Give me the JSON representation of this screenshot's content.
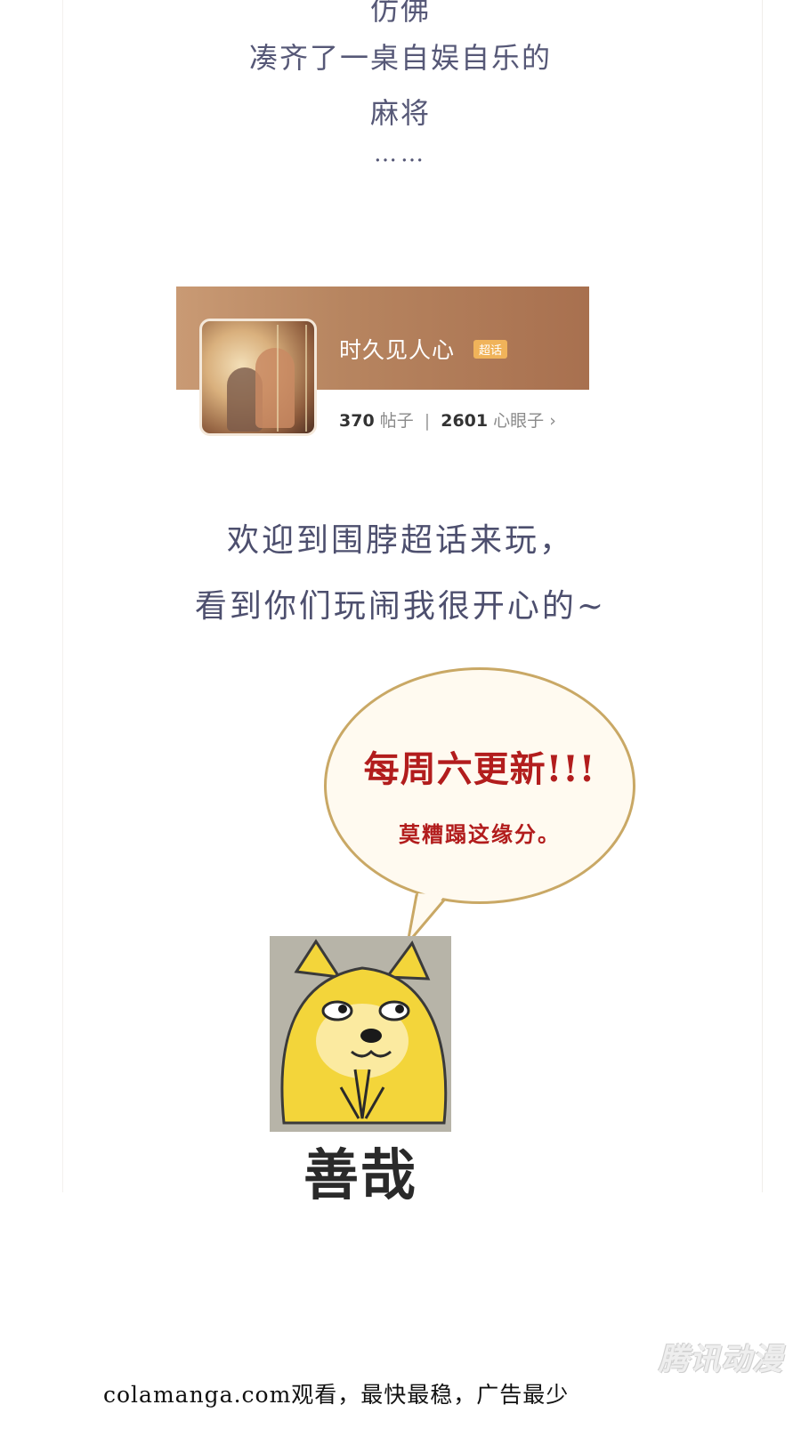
{
  "poem": {
    "line_top": "仿佛",
    "line_2": "凑齐了一桌自娱自乐的",
    "line_3": "麻将",
    "dots": "……"
  },
  "card": {
    "title": "时久见人心",
    "badge": "超话",
    "posts_count": "370",
    "posts_label": "帖子",
    "separator": "|",
    "fans_count": "2601",
    "fans_label": "心眼子",
    "chevron": "›"
  },
  "welcome": {
    "line_1": "欢迎到围脖超话来玩，",
    "line_2": "看到你们玩闹我很开心的~"
  },
  "bubble": {
    "main": "每周六更新!!!",
    "sub": "莫糟蹋这缘分。"
  },
  "meme": {
    "caption": "善哉"
  },
  "footer": {
    "text": "colamanga.com观看，最快最稳，广告最少"
  },
  "watermark": {
    "text": "腾讯动漫"
  },
  "colors": {
    "poem_text": "#565877",
    "bubble_text": "#b21d1d",
    "card_banner": "#b78560",
    "badge": "#f0b35a"
  }
}
